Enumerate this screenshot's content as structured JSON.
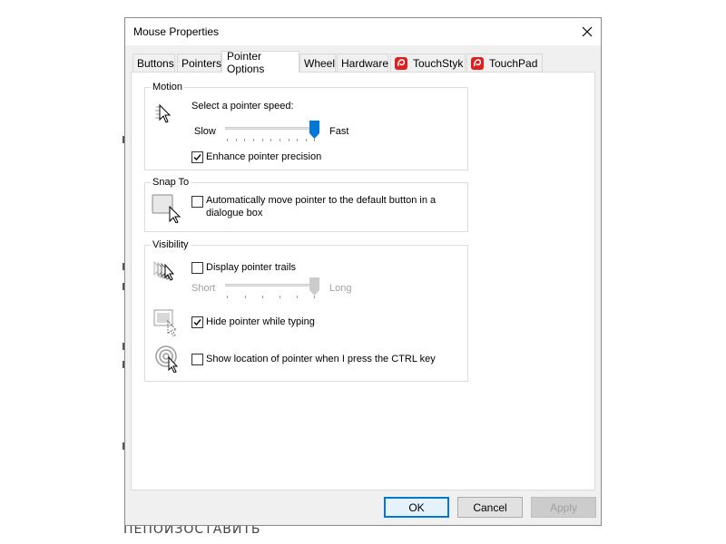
{
  "window": {
    "title": "Mouse Properties",
    "close_label": "✕"
  },
  "tabs": [
    {
      "label": "Buttons"
    },
    {
      "label": "Pointers"
    },
    {
      "label": "Pointer Options",
      "active": true
    },
    {
      "label": "Wheel"
    },
    {
      "label": "Hardware"
    },
    {
      "label": "TouchStyk",
      "icon": "touchstyk-logo-icon"
    },
    {
      "label": "TouchPad",
      "icon": "touchpad-logo-icon"
    }
  ],
  "motion": {
    "group_label": "Motion",
    "speed_label": "Select a pointer speed:",
    "slow_label": "Slow",
    "fast_label": "Fast",
    "speed_value": 1.0,
    "enhance_label": "Enhance pointer precision",
    "enhance_checked": true
  },
  "snap_to": {
    "group_label": "Snap To",
    "auto_move_line1": "Automatically move pointer to the default button in a",
    "auto_move_line2": "dialogue box",
    "auto_move_checked": false
  },
  "visibility": {
    "group_label": "Visibility",
    "trails_label": "Display pointer trails",
    "trails_checked": false,
    "short_label": "Short",
    "long_label": "Long",
    "trails_value": 1.0,
    "hide_label": "Hide pointer while typing",
    "hide_checked": true,
    "ctrl_label": "Show location of pointer when I press the CTRL key",
    "ctrl_checked": false
  },
  "buttons": {
    "ok": "OK",
    "cancel": "Cancel",
    "apply": "Apply"
  },
  "background_text": "ПЕПОИЗОСТАВИТЬ",
  "colors": {
    "accent": "#0078d7",
    "logo_red": "#e02020"
  }
}
